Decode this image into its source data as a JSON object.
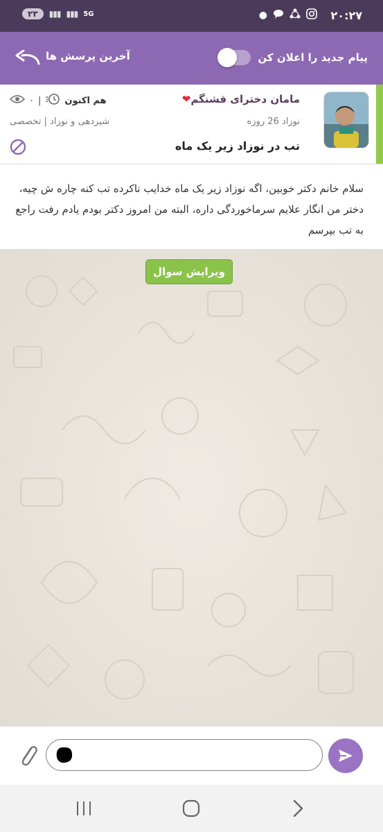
{
  "status_bar": {
    "time": "۲۰:۲۷",
    "battery": "۲۳",
    "network": "5G",
    "icons": [
      "dot-icon",
      "chat-bubble-icon",
      "share-icon",
      "instagram-icon"
    ]
  },
  "toolbar": {
    "notify_label": "پیام جدید را اعلان کن",
    "notify_enabled": false,
    "recent_questions_label": "آخرین پرسش ها",
    "back_icon": "back-arrow-icon"
  },
  "question": {
    "author": "مامان دخترای قشنگم",
    "author_emoji": "❤",
    "baby_age": "نوزاد 26 روزه",
    "title": "تب در نوزاد زیر یک ماه",
    "posted_time": "هم اکنون",
    "views": "۰",
    "category": "شیردهی و نوزاد | تخصصی",
    "body": "سلام خانم دکتر خوبین، اگه نوزاد زیر یک ماه خدایب ناکرده تب کنه چاره ش چیه، دختر من انگار علایم سرماخوردگی داره، البته من امروز دکتر بودم یادم رفت راجع به تب بپرسم"
  },
  "chat": {
    "edit_button_label": "ویرایش سوال"
  },
  "input_bar": {
    "message_value": "",
    "attach_icon": "paperclip-icon",
    "send_icon": "send-icon"
  },
  "colors": {
    "status_bar": "#4b3b5b",
    "toolbar": "#8e69b3",
    "accent_green": "#8bc34a",
    "send_button": "#9b73c5"
  }
}
